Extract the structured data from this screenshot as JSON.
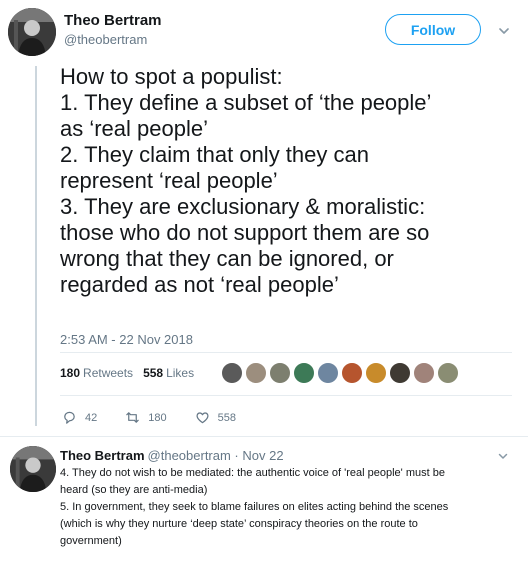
{
  "tweet": {
    "author_name": "Theo Bertram",
    "author_handle": "@theobertram",
    "follow_label": "Follow",
    "text_lines": [
      "How to spot a populist:",
      "1. They define a subset of ‘the people’",
      "as ‘real people’",
      "2. They claim that only they can",
      "represent ‘real people’",
      "3. They are exclusionary & moralistic:",
      "those who do not support them are so",
      "wrong that they can be ignored, or",
      "regarded as not ‘real people’"
    ],
    "timestamp": "2:53 AM - 22 Nov 2018",
    "retweets_count": "180",
    "retweets_label": "Retweets",
    "likes_count": "558",
    "likes_label": "Likes",
    "liker_colors": [
      "#5a5a5a",
      "#9c8e7e",
      "#7d7f6f",
      "#3d7a57",
      "#6e86a0",
      "#b6552e",
      "#c88b2b",
      "#3f3a33",
      "#a0837a",
      "#8a8d73"
    ],
    "reply_count": "42",
    "retweet_action_count": "180",
    "like_action_count": "558"
  },
  "reply": {
    "author_name": "Theo Bertram",
    "author_handle": "@theobertram · Nov 22",
    "text_lines": [
      "4. They do not wish to be mediated: the authentic voice of 'real people' must be",
      "heard (so they are anti-media)",
      "5. In government, they seek to blame failures on elites acting behind the scenes",
      "(which is why they nurture ‘deep state’ conspiracy theories on the route to",
      "government)"
    ]
  }
}
